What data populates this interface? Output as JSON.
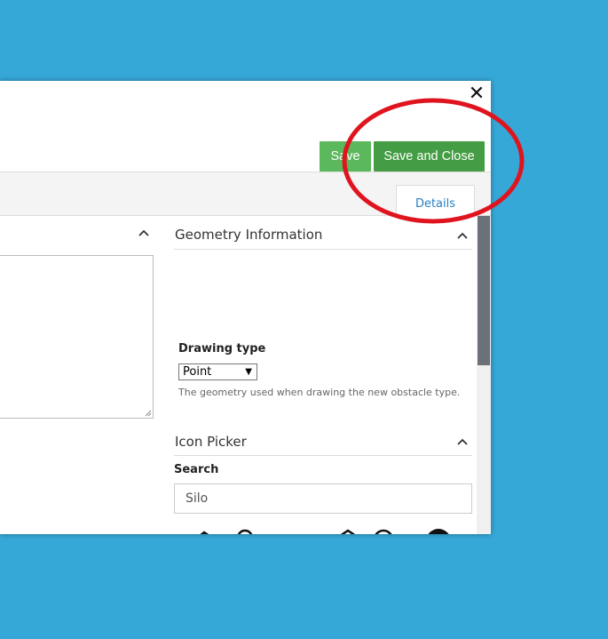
{
  "dialog": {
    "close_symbol": "✕",
    "save_label": "Save",
    "save_and_close_label": "Save and Close",
    "tabs": {
      "details": "Details"
    }
  },
  "geometry": {
    "title": "Geometry Information",
    "drawing_type_label": "Drawing type",
    "drawing_type_value": "Point",
    "help": "The geometry used when drawing the new obstacle type."
  },
  "icon_picker": {
    "title": "Icon Picker",
    "search_label": "Search",
    "search_value": "Silo",
    "icons": [
      "silo-barn-icon",
      "silo-tall-icon",
      "silo-row-icon",
      "silo-tanks-icon",
      "silo-ladder-icon",
      "silo-dark-icon",
      "silo-ladder-barn-icon",
      "silo-barn-dark-icon",
      "silo-x-icon",
      "silo-x-dark-icon",
      "silo-twin-ladder-icon",
      "silo-single-dark-icon"
    ]
  },
  "colors": {
    "background": "#36a8d8",
    "save": "#5cb85c",
    "save_and_close": "#449d44",
    "link": "#2680c5",
    "annotation": "#e0141e"
  },
  "icons": [
    "close-icon",
    "chevron-up-icon",
    "dropdown-arrow-icon",
    "resize-grip-icon"
  ]
}
